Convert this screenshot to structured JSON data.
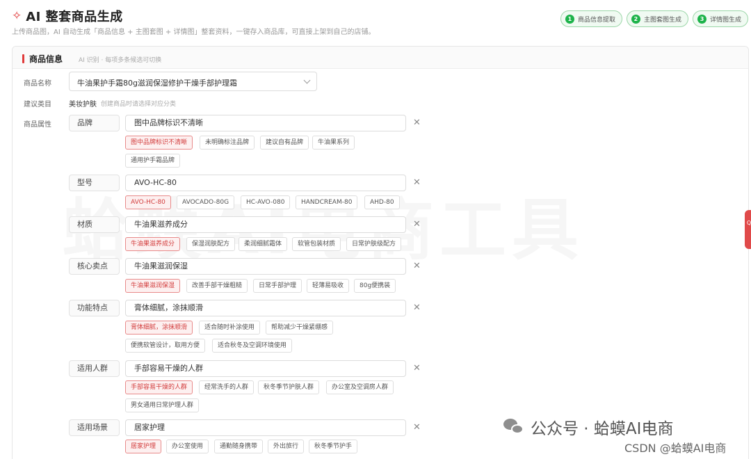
{
  "header": {
    "icon": "sparkle-icon",
    "title": "AI 整套商品生成",
    "subtitle": "上传商品图，AI 自动生成「商品信息 + 主图套图 + 详情图」整套资料，一键存入商品库，可直接上架到自己的店铺。",
    "steps": [
      {
        "num": "1",
        "label": "商品信息提取"
      },
      {
        "num": "2",
        "label": "主图套图生成"
      },
      {
        "num": "3",
        "label": "详情图生成"
      }
    ]
  },
  "card": {
    "title": "商品信息",
    "hint": "AI 识别 · 每项多条候选可切换"
  },
  "form": {
    "name_label": "商品名称",
    "name_value": "牛油果护手霜80g滋润保湿修护干燥手部护理霜",
    "category_label": "建议类目",
    "category_value": "美妆护肤",
    "category_hint": "创建商品时请选择对应分类",
    "attrs_label": "商品属性"
  },
  "attributes": [
    {
      "key": "品牌",
      "value": "图中品牌标识不清晰",
      "options": [
        "图中品牌标识不清晰",
        "未明确标注品牌",
        "建议自有品牌",
        "牛油果系列",
        "通用护手霜品牌"
      ]
    },
    {
      "key": "型号",
      "value": "AVO-HC-80",
      "options": [
        "AVO-HC-80",
        "AVOCADO-80G",
        "HC-AVO-080",
        "HANDCREAM-80",
        "AHD-80"
      ]
    },
    {
      "key": "材质",
      "value": "牛油果滋养成分",
      "options": [
        "牛油果滋养成分",
        "保湿润肤配方",
        "柔润细腻霜体",
        "软管包装材质",
        "日常护肤级配方"
      ]
    },
    {
      "key": "核心卖点",
      "value": "牛油果滋润保湿",
      "options": [
        "牛油果滋润保湿",
        "改善手部干燥粗糙",
        "日常手部护理",
        "轻薄易吸收",
        "80g便携装"
      ]
    },
    {
      "key": "功能特点",
      "value": "膏体细腻，涂抹顺滑",
      "options": [
        "膏体细腻，涂抹顺滑",
        "适合随时补涂使用",
        "帮助减少干燥紧绷感",
        "便携软管设计，取用方便",
        "适合秋冬及空调环境使用"
      ]
    },
    {
      "key": "适用人群",
      "value": "手部容易干燥的人群",
      "options": [
        "手部容易干燥的人群",
        "经常洗手的人群",
        "秋冬季节护肤人群",
        "办公室及空调房人群",
        "男女通用日常护理人群"
      ]
    },
    {
      "key": "适用场景",
      "value": "居家护理",
      "options": [
        "居家护理",
        "办公室使用",
        "通勤随身携带",
        "外出旅行",
        "秋冬季节护手"
      ]
    }
  ],
  "side_tab": "Q",
  "watermark": "蛤蟆AI电商工具",
  "footer": {
    "wechat": "公众号 · 蛤蟆AI电商",
    "csdn": "CSDN @蛤蟆AI电商"
  },
  "colors": {
    "accent": "#e03a3a",
    "step_green": "#1db34a",
    "chip_selected_bg": "#fdf0f0"
  }
}
